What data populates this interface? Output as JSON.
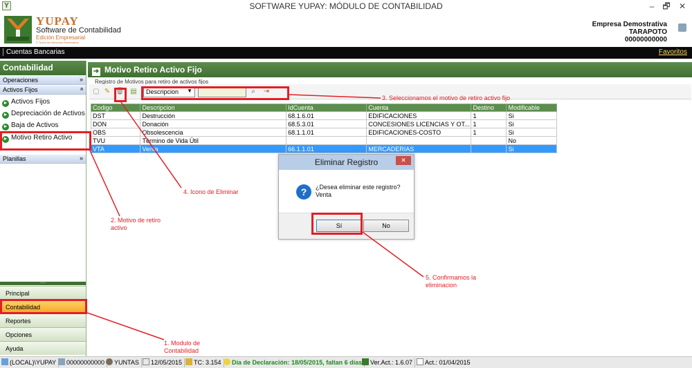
{
  "window": {
    "title": "SOFTWARE YUPAY: MÓDULO DE CONTABILIDAD",
    "controls": [
      "–",
      "🗗",
      "✕"
    ]
  },
  "brand": {
    "name": "YUPAY",
    "subtitle": "Software de Contabilidad",
    "edition": "Edición Empresarial",
    "tagline": "© Todos los Derechos Reservados"
  },
  "company": {
    "name": "Empresa Demostrativa",
    "city": "TARAPOTO",
    "ruc": "00000000000"
  },
  "topbar": {
    "cuentas": "Cuentas Bancarias",
    "favoritos": "Favoritos"
  },
  "sidebar": {
    "header": "Contabilidad",
    "sections": {
      "operaciones": "Operaciones",
      "activos_fijos": "Activos Fijos",
      "planillas": "Planillas"
    },
    "items": [
      "Activos Fijos",
      "Depreciación de Activos",
      "Baja de Activos",
      "Motivo Retiro Activo"
    ],
    "grip": ".....",
    "nav": [
      "Principal",
      "Contabilidad",
      "Reportes",
      "Opciones",
      "Ayuda"
    ]
  },
  "main": {
    "title": "Motivo Retiro Activo Fijo",
    "subtitle": "Registro de Motivos para retiro de activos fijos",
    "toolbar": {
      "search_field": "Descripcion",
      "search_value": ""
    }
  },
  "table": {
    "columns": [
      "Codigo",
      "Descripcion",
      "IdCuenta",
      "Cuenta",
      "Destino",
      "Modificable"
    ],
    "rows": [
      [
        "DST",
        "Destrucción",
        "68.1.6.01",
        "EDIFICACIONES",
        "1",
        "Si"
      ],
      [
        "DON",
        "Donación",
        "68.5.3.01",
        "CONCESIONES LICENCIAS Y OT...",
        "1",
        "Si"
      ],
      [
        "OBS",
        "Obsolescencia",
        "68.1.1.01",
        "EDIFICACIONES-COSTO",
        "1",
        "Si"
      ],
      [
        "TVU",
        "Término de Vida Útil",
        "",
        "",
        "",
        "No"
      ],
      [
        "VTA",
        "Venta",
        "66.1.1.01",
        "MERCADERIAS",
        "",
        "Si"
      ]
    ],
    "selected_row": 4
  },
  "dialog": {
    "title": "Eliminar Registro",
    "close": "✕",
    "message_line1": "¿Desea eliminar este registro?",
    "message_line2": "Venta",
    "yes": "Sí",
    "no": "No"
  },
  "annotations": {
    "a1_line1": "1. Modulo de",
    "a1_line2": "Contabilidad",
    "a2_line1": "2. Motivo  de retiro",
    "a2_line2": "activo",
    "a3": "3. Seleccionamos el motivo de retiro activo fijo",
    "a4": "4. Icono de Eliminar",
    "a5_line1": "5. Confirmamos la",
    "a5_line2": "eliminacion",
    "color": "#e31e24"
  },
  "statusbar": {
    "server": "(LOCAL)\\YUPAY",
    "ruc": "00000000000",
    "user": "YUNTAS",
    "date": "12/05/2015",
    "tc": "TC: 3.154",
    "declaracion": "Día de Declaración: 18/05/2015, faltan 6 días",
    "version": "Ver.Act.: 1.6.07",
    "act": "Act.: 01/04/2015"
  },
  "colors": {
    "green_header": "#4a7c3b",
    "selected_row": "#3399ff",
    "active_nav": "#f5a623",
    "dialog_title": "#b7cde8"
  }
}
